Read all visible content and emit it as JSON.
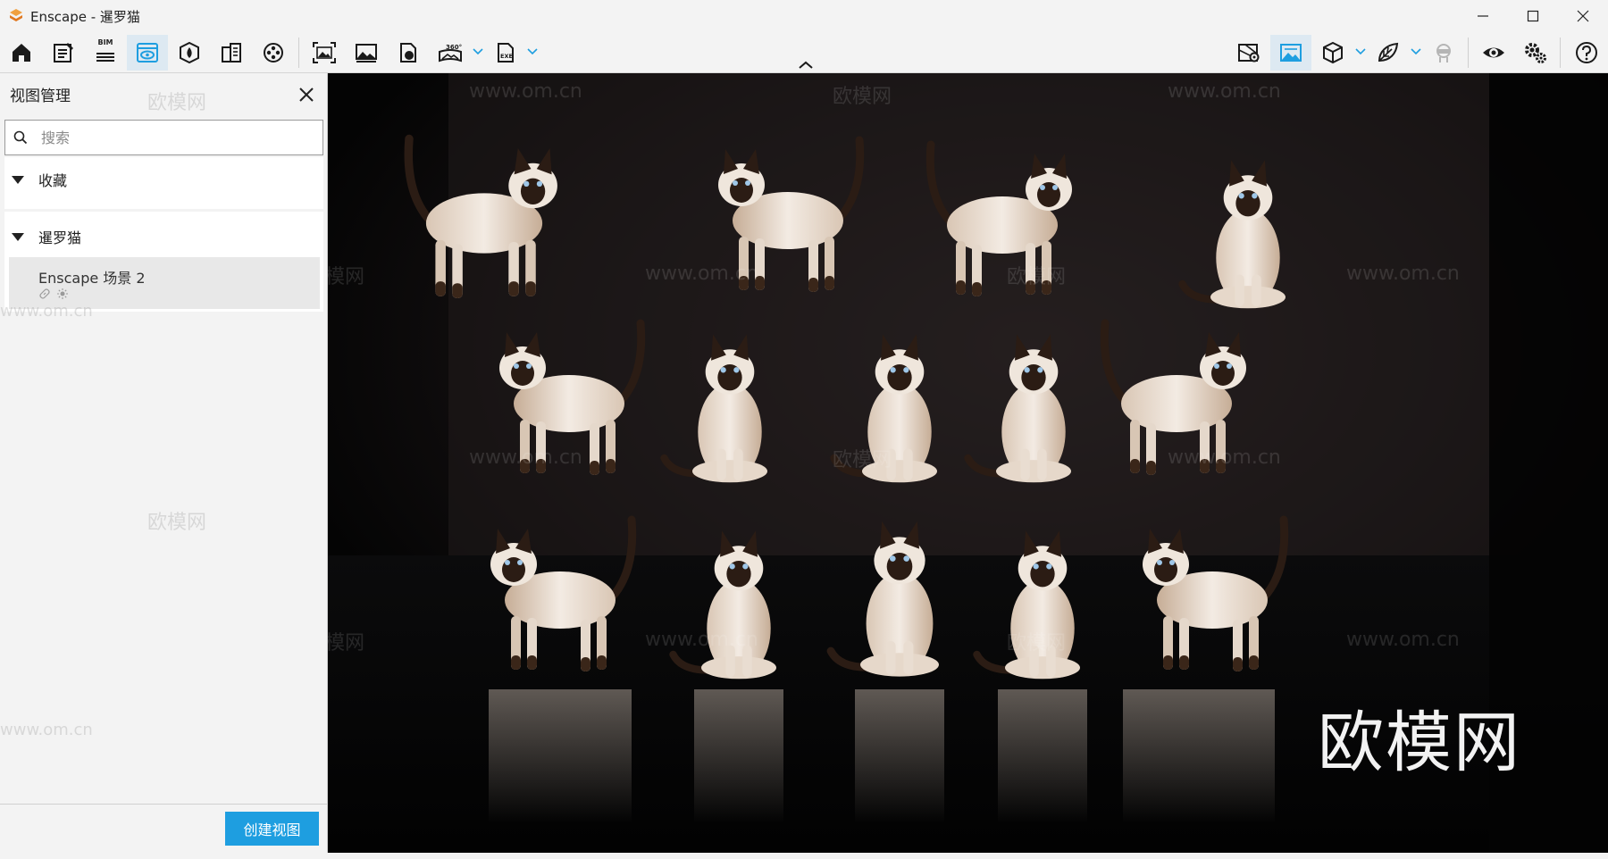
{
  "window": {
    "title": "Enscape - 暹罗猫"
  },
  "panel": {
    "title": "视图管理",
    "search_placeholder": "搜索",
    "groups": [
      {
        "label": "收藏"
      },
      {
        "label": "暹罗猫"
      }
    ],
    "views": [
      {
        "label": "Enscape 场景 2"
      }
    ],
    "create_button": "创建视图"
  },
  "toolbar": {
    "bim_label": "BIM",
    "icons_left": [
      "home-icon",
      "notes-icon",
      "bim-icon",
      "view-management-icon",
      "asset-library-icon",
      "buildings-icon",
      "video-editor-icon"
    ],
    "icons_capture": [
      "screenshot-icon",
      "batch-render-icon",
      "web-standalone-icon",
      "panorama-360-icon",
      "export-exe-icon"
    ],
    "icons_right": [
      "site-context-icon",
      "render-image-icon",
      "visual-settings-cube-icon",
      "material-editor-icon",
      "vr-headset-icon",
      "eye-icon",
      "settings-icon",
      "help-icon"
    ]
  },
  "viewport": {
    "watermark_big": "欧模网",
    "watermark_text": "欧模网",
    "watermark_url": "www.om.cn",
    "background_color": "#050505",
    "cat_fur_color": "#efe6dc",
    "cat_point_color": "#2b1c14"
  },
  "colors": {
    "accent": "#1e9ee0",
    "active_tab": "#dde9f2",
    "logo": "#e9862a"
  }
}
